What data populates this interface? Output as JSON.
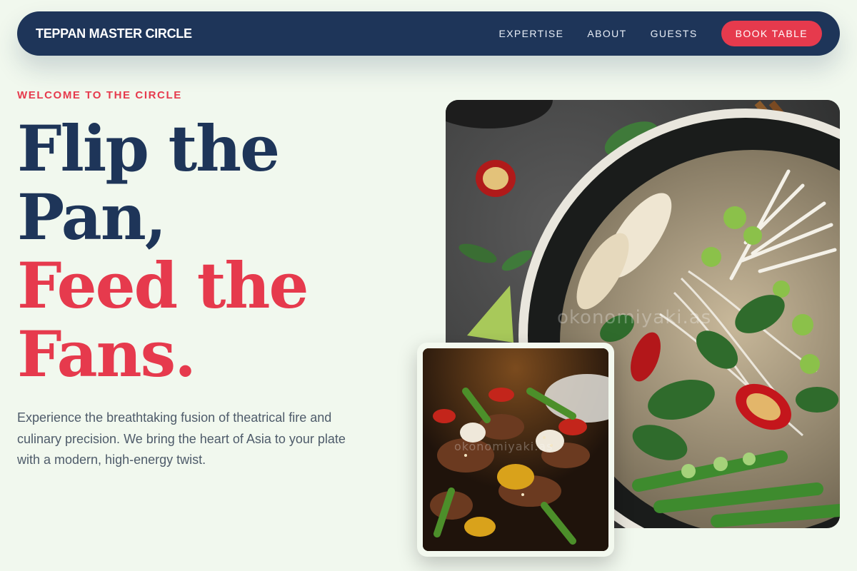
{
  "header": {
    "brand": "TEPPAN MASTER CIRCLE",
    "nav_items": [
      {
        "label": "EXPERTISE"
      },
      {
        "label": "ABOUT"
      },
      {
        "label": "GUESTS"
      }
    ],
    "cta_label": "BOOK TABLE"
  },
  "hero": {
    "eyebrow": "WELCOME TO THE CIRCLE",
    "headline_line1": "Flip the",
    "headline_line2": "Pan,",
    "headline_line3": "Feed the",
    "headline_line4": "Fans.",
    "description": "Experience the breathtaking fusion of theatrical fire and culinary precision. We bring the heart of Asia to your plate with a modern, high-energy twist."
  },
  "images": {
    "main_watermark": "okonomiyaki.as",
    "inset_watermark": "okonomiyaki.as"
  },
  "colors": {
    "navy": "#1e3559",
    "accent_red": "#e63a4d",
    "background": "#f1f8ee"
  }
}
